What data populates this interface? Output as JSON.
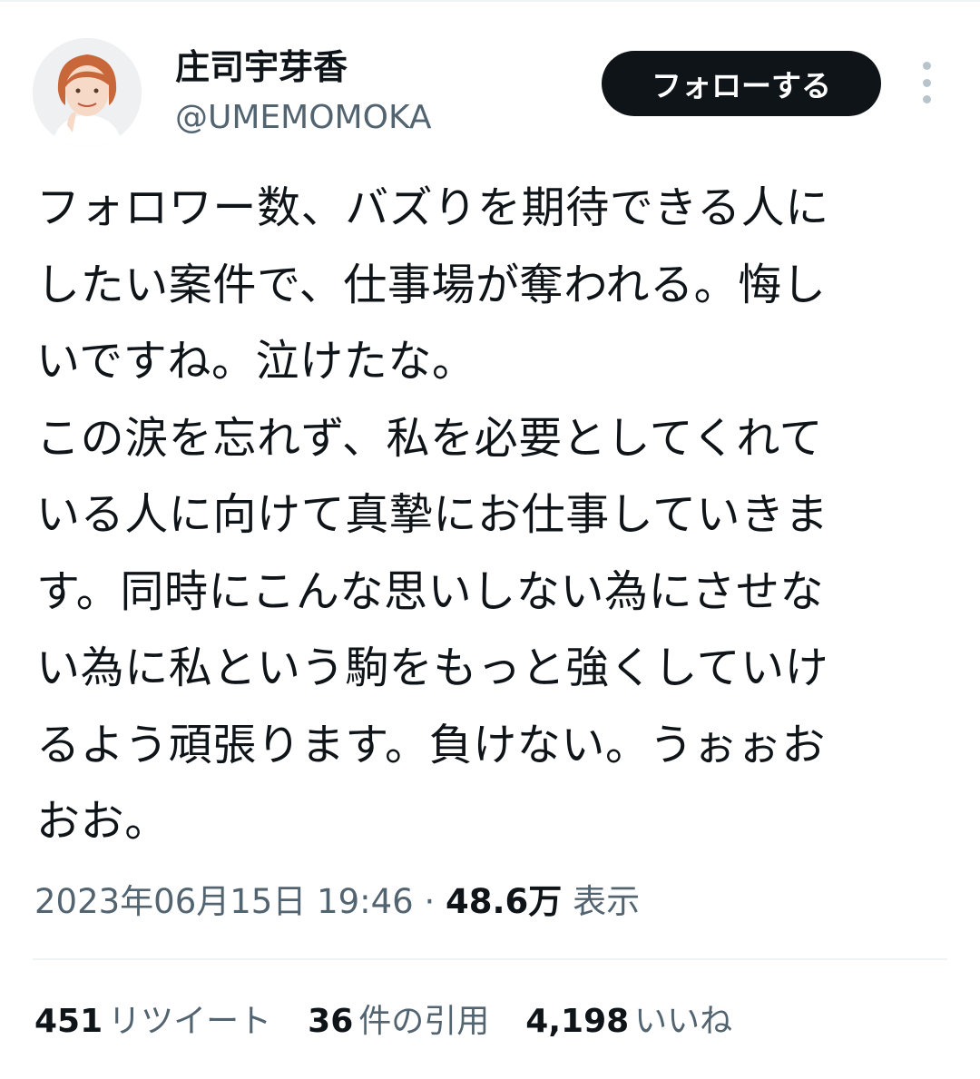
{
  "profile": {
    "display_name": "庄司宇芽香",
    "handle": "@UMEMOMOKA",
    "follow_label": "フォローする"
  },
  "tweet": {
    "lines": [
      "フォロワー数、バズりを期待できる人に",
      "したい案件で、仕事場が奪われる。悔し",
      "いですね。泣けたな。",
      "この涙を忘れず、私を必要としてくれて",
      "いる人に向けて真摯にお仕事していきま",
      "す。同時にこんな思いしない為にさせな",
      "い為に私という駒をもっと強くしていけ",
      "るよう頑張ります。負けない。うぉぉお",
      "おお。"
    ]
  },
  "meta": {
    "timestamp": "2023年06月15日 19:46",
    "separator": " · ",
    "views_count": "48.6万",
    "views_label": "表示"
  },
  "stats": [
    {
      "count": "451",
      "label": "リツイート"
    },
    {
      "count": "36",
      "label": "件の引用"
    },
    {
      "count": "4,198",
      "label": "いいね"
    }
  ],
  "colors": {
    "text": "#0f1419",
    "secondary": "#536471",
    "button_bg": "#0f1419",
    "divider": "#eff3f4"
  }
}
